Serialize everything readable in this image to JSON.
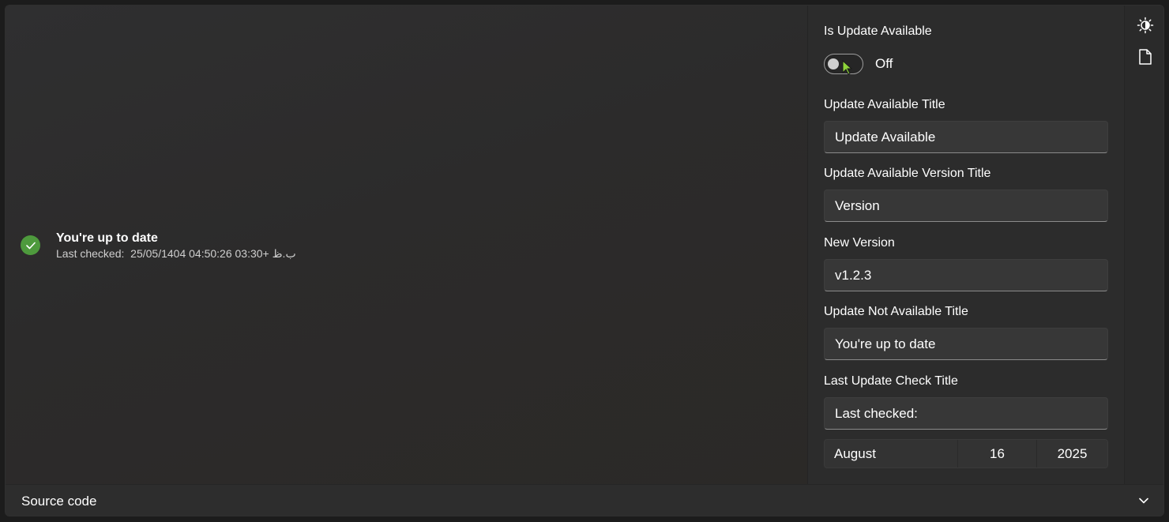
{
  "preview": {
    "status_title": "You're up to date",
    "status_subtitle": "Last checked:  25/05/1404 04:50:26 03:30+ ب.ظ"
  },
  "options": {
    "is_update_available": {
      "label": "Is Update Available",
      "state": "Off"
    },
    "update_available_title": {
      "label": "Update Available Title",
      "value": "Update Available"
    },
    "update_available_version_title": {
      "label": "Update Available Version Title",
      "value": "Version"
    },
    "new_version": {
      "label": "New Version",
      "value": "v1.2.3"
    },
    "update_not_available_title": {
      "label": "Update Not Available Title",
      "value": "You're up to date"
    },
    "last_update_check_title": {
      "label": "Last Update Check Title",
      "value": "Last checked:"
    },
    "date": {
      "month": "August",
      "day": "16",
      "year": "2025"
    }
  },
  "rail": {
    "theme_icon": "theme-toggle-icon",
    "doc_icon": "document-icon"
  },
  "footer": {
    "title": "Source code"
  },
  "colors": {
    "accent_green": "#4e9a3d",
    "background": "#2b2b2b"
  }
}
